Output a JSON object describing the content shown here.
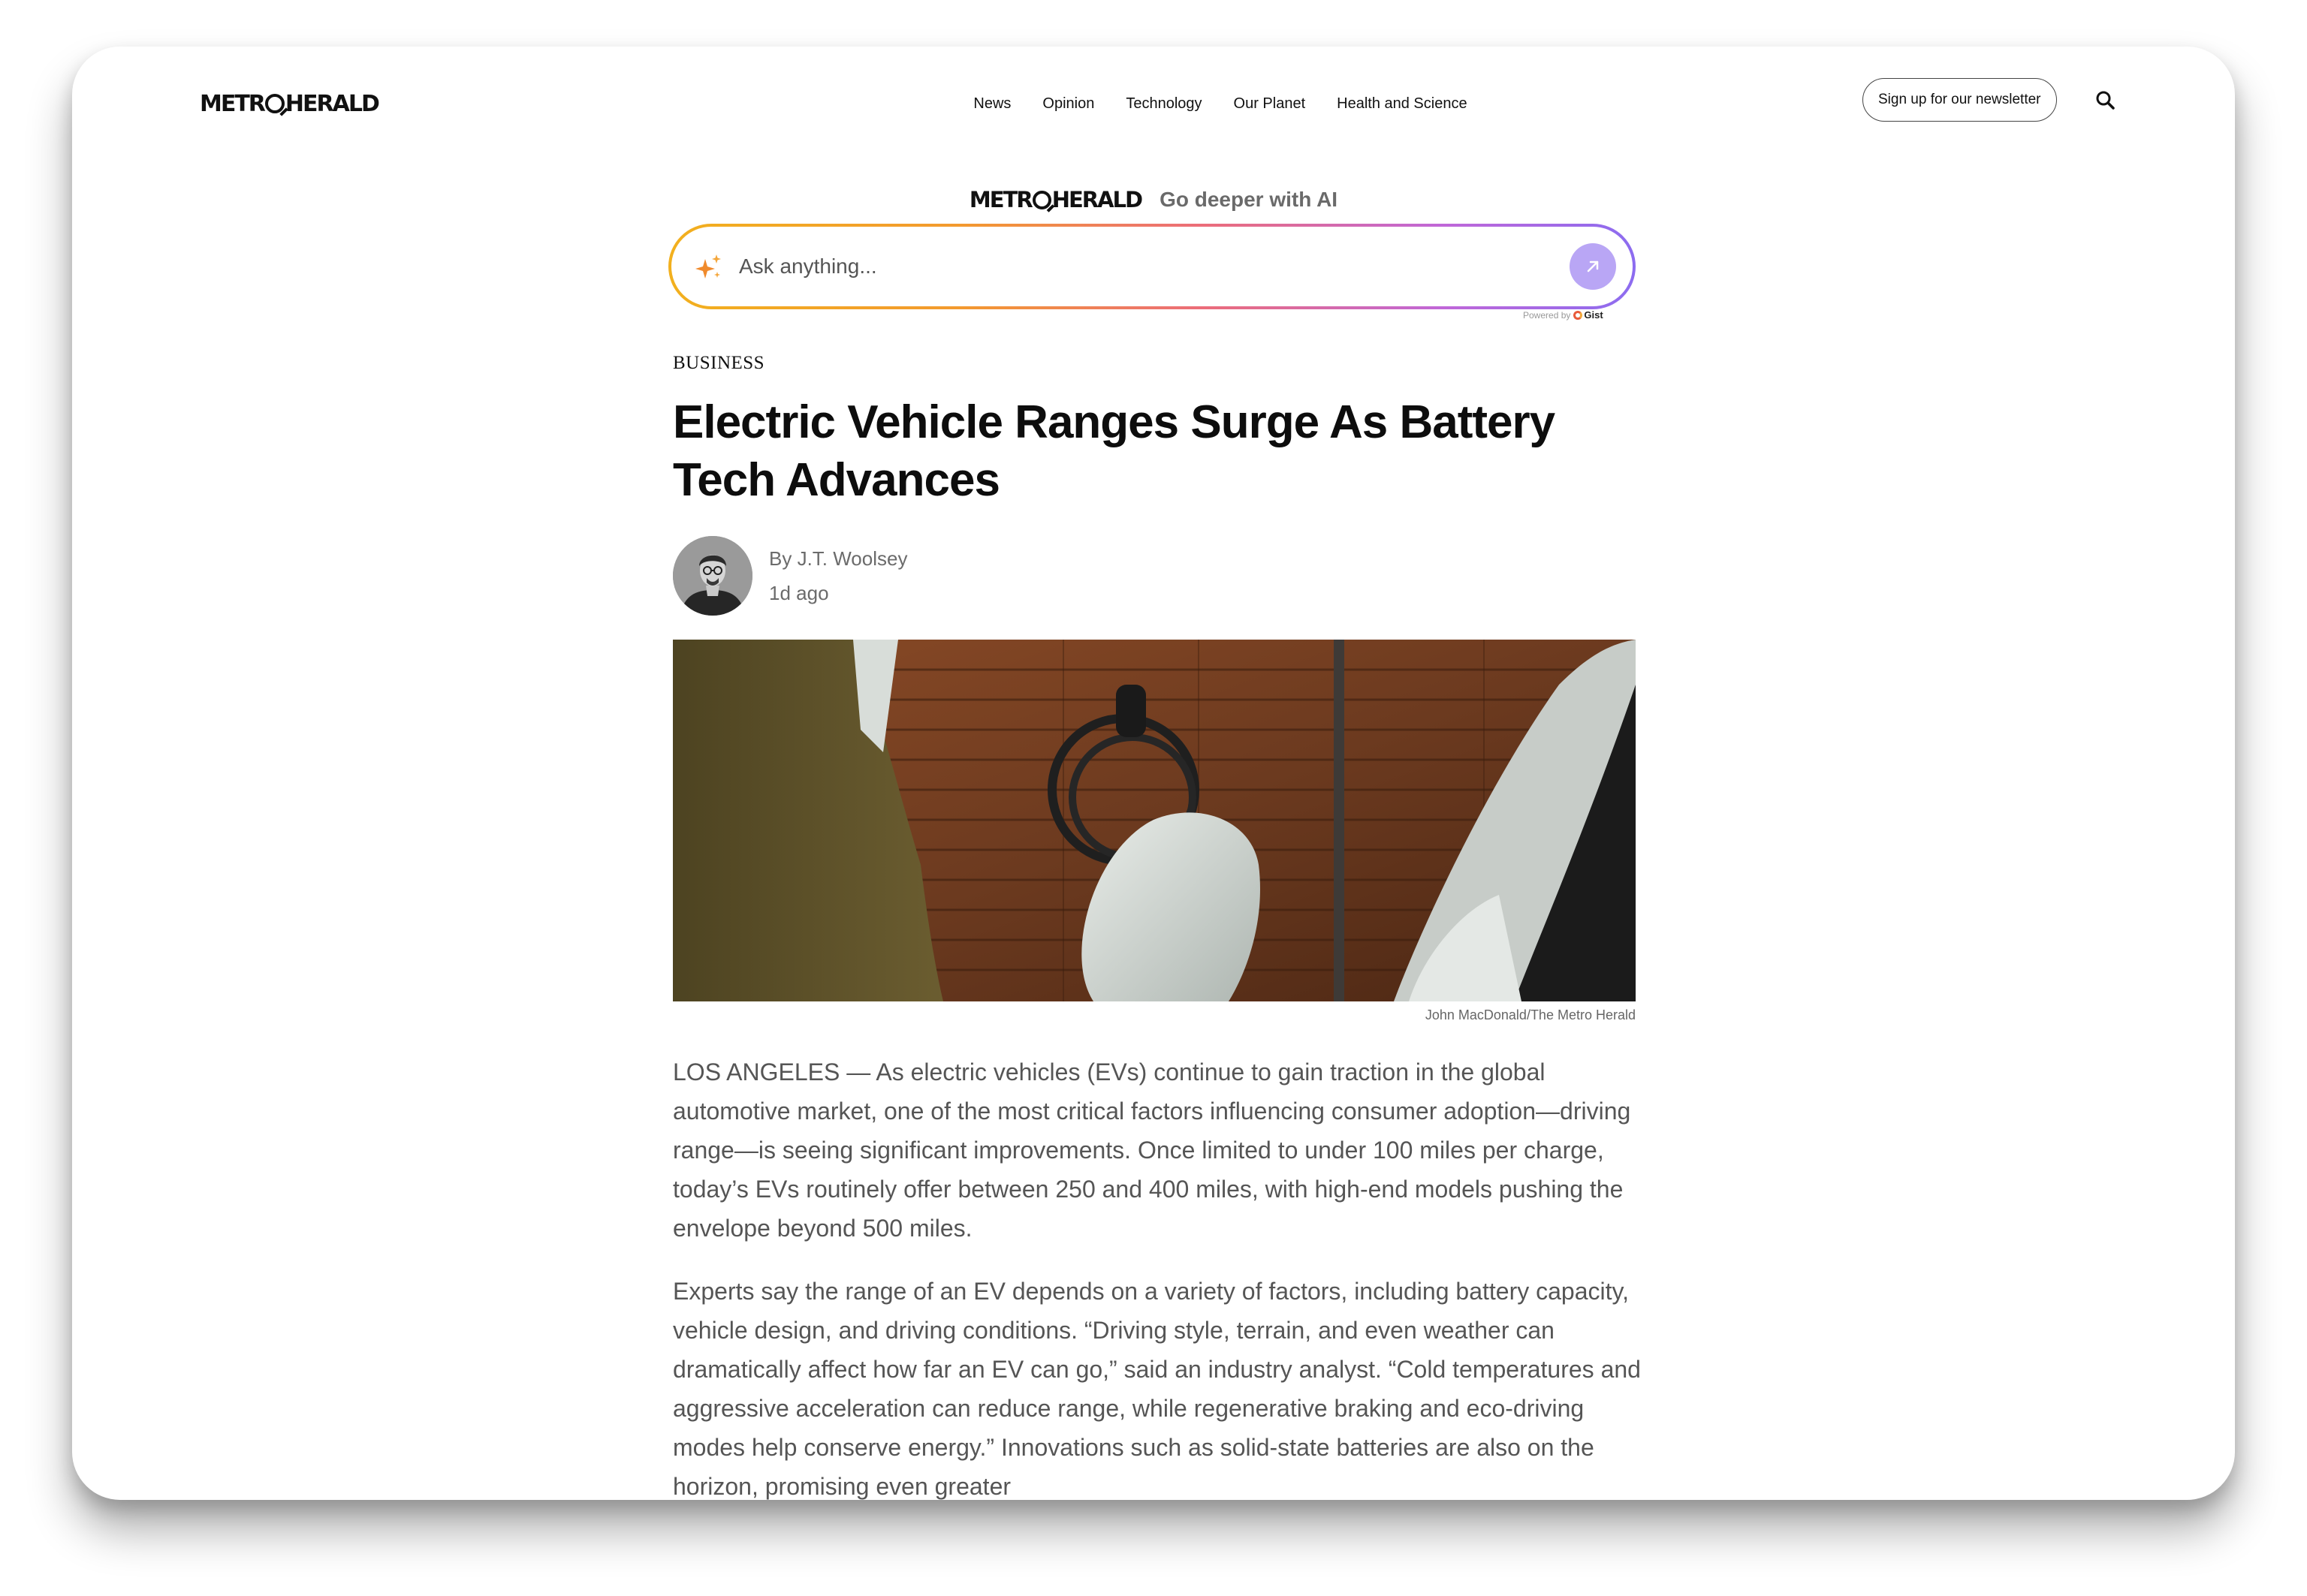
{
  "header": {
    "logo": {
      "left": "METR",
      "right": "HERALD"
    },
    "nav": [
      "News",
      "Opinion",
      "Technology",
      "Our Planet",
      "Health and Science"
    ],
    "newsletter_label": "Sign up for our newsletter"
  },
  "ai": {
    "logo": {
      "left": "METR",
      "right": "HERALD"
    },
    "tagline": "Go deeper with AI",
    "placeholder": "Ask anything...",
    "powered_by": "Powered by",
    "powered_brand": "Gist"
  },
  "article": {
    "section": "BUSINESS",
    "headline": "Electric Vehicle Ranges Surge As Battery Tech Advances",
    "author": "By J.T. Woolsey",
    "time": "1d ago",
    "image_caption": "John MacDonald/The Metro Herald",
    "paragraphs": [
      "LOS ANGELES — As electric vehicles (EVs) continue to gain traction in the global automotive market, one of the most critical factors influencing consumer adoption—driving range—is seeing significant improvements. Once limited to under 100 miles per charge, today’s EVs routinely offer between 250 and 400 miles, with high-end models pushing the envelope beyond 500 miles.",
      "Experts say the range of an EV depends on a variety of factors, including battery capacity, vehicle design, and driving conditions. “Driving style, terrain, and even weather can dramatically affect how far an EV can go,” said an industry analyst. “Cold temperatures and aggressive acceleration can reduce range, while regenerative braking and eco-driving modes help conserve energy.” Innovations such as solid-state batteries are also on the horizon, promising even greater"
    ]
  }
}
